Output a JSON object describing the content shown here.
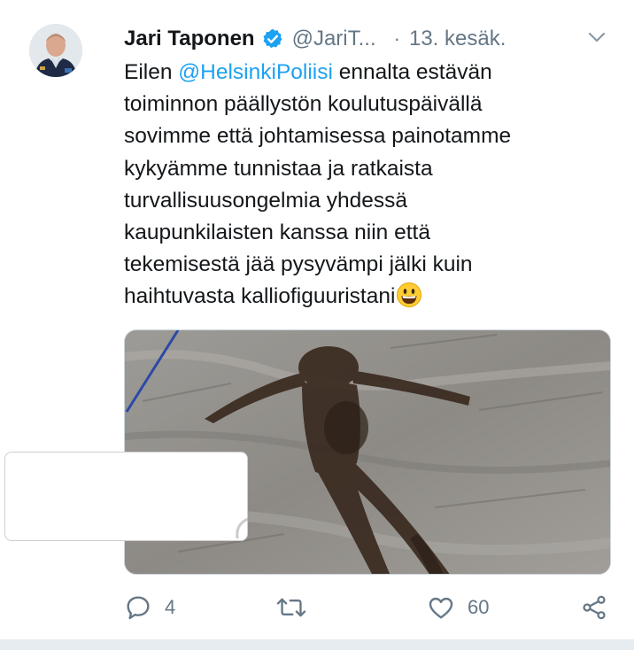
{
  "tweet": {
    "author_name": "Jari Taponen",
    "handle": "@JariT...",
    "separator": "·",
    "date": "13. kesäk.",
    "text_lines": [
      {
        "prefix": "Eilen ",
        "mention": "@HelsinkiPoliisi",
        "suffix": " ennalta estävän"
      },
      "toiminnon päällystön koulutuspäivällä",
      "sovimme että johtamisessa painotamme",
      "kykyämme tunnistaa ja ratkaista",
      "turvallisuusongelmia yhdessä",
      "kaupunkilaisten kanssa niin että",
      "tekemisestä jää pysyvämpi jälki kuin",
      "haihtuvasta kalliofiguuristani"
    ],
    "emoji": "grinning-face-emoji"
  },
  "actions": {
    "reply_count": "4",
    "retweet_count": "",
    "like_count": "60"
  },
  "colors": {
    "link": "#1da1f2",
    "secondary_text": "#657786",
    "verified_badge": "#1da1f2"
  },
  "icons": [
    "verified-badge-icon",
    "chevron-down-icon",
    "reply-icon",
    "retweet-icon",
    "like-icon",
    "share-icon"
  ]
}
